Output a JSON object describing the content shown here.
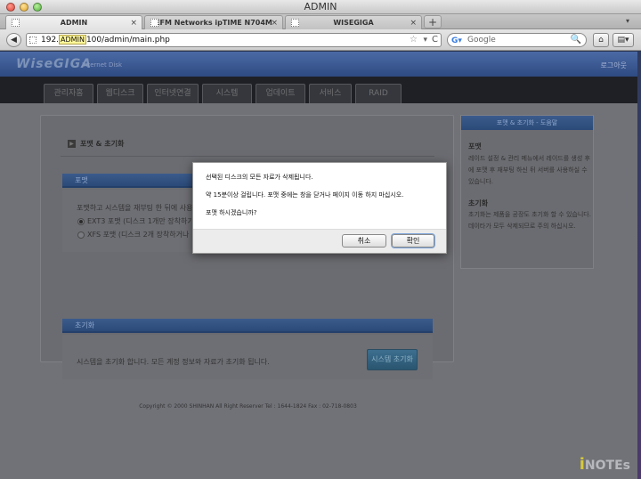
{
  "window": {
    "title": "ADMIN"
  },
  "tabs": [
    {
      "label": "ADMIN",
      "close": "×"
    },
    {
      "label": "EFM Networks ipTIME N704M",
      "close": "×"
    },
    {
      "label": "WISEGIGA",
      "close": "×"
    }
  ],
  "newtab": "+",
  "tab_menu": "▾",
  "toolbar": {
    "back": "◀",
    "url_prefix": "192.",
    "url_tooltip": "ADMIN",
    "url_suffix": "100/admin/main.php",
    "star": "☆",
    "dropdown": "▾",
    "reload": "C",
    "search_engine": "G▾",
    "search_placeholder": "Google",
    "search_glass": "🔍",
    "home": "⌂",
    "sidebar": "▤▾"
  },
  "site": {
    "logo": "WiseGIGA",
    "logo_sub": "Internet Disk",
    "logout": "로그아웃",
    "menu": [
      "관리자홈",
      "웹디스크",
      "인터넷연결",
      "시스템",
      "업데이트",
      "서비스",
      "RAID"
    ]
  },
  "main": {
    "section_title": "포맷 & 초기화",
    "format": {
      "header": "포맷",
      "desc": "포맷하고 시스템을 재부팅 한 뒤에 사용",
      "options": [
        "EXT3 포맷 (디스크 1개만 장착하기",
        "XFS 포맷 (디스크 2개 장착하거나"
      ]
    },
    "init": {
      "header": "초기화",
      "desc": "시스템을 초기화 합니다. 모든 계정 정보와 자료가 초기화 됩니다.",
      "button": "시스템 초기화"
    },
    "copyright": "Copyright © 2000 SHINHAN All Right Reserver Tel : 1644-1824 Fax : 02-718-0803"
  },
  "help": {
    "header": "포맷 & 초기화 - 도움말",
    "items": [
      {
        "title": "포맷",
        "text": "레이드 설정 & 관리 메뉴에서 레이드를 생성 후에 포맷 후 재부팅 하신 뒤 서버를 사용하실 수 있습니다."
      },
      {
        "title": "초기화",
        "text": "초기화는 제품을 공장도 초기화 할 수 있습니다. 데이타가 모두 삭제되므로 주의 하십시오."
      }
    ]
  },
  "dialog": {
    "lines": [
      "선택된 디스크의 모든 자료가 삭제됩니다.",
      "약 15분이상 걸립니다. 포맷 중에는 창을 닫거나 페이지 이동 하지 마십시오.",
      "포맷 하시겠습니까?"
    ],
    "cancel": "취소",
    "confirm": "확인"
  },
  "watermark": {
    "i": "i",
    "rest": "NOTEs"
  }
}
